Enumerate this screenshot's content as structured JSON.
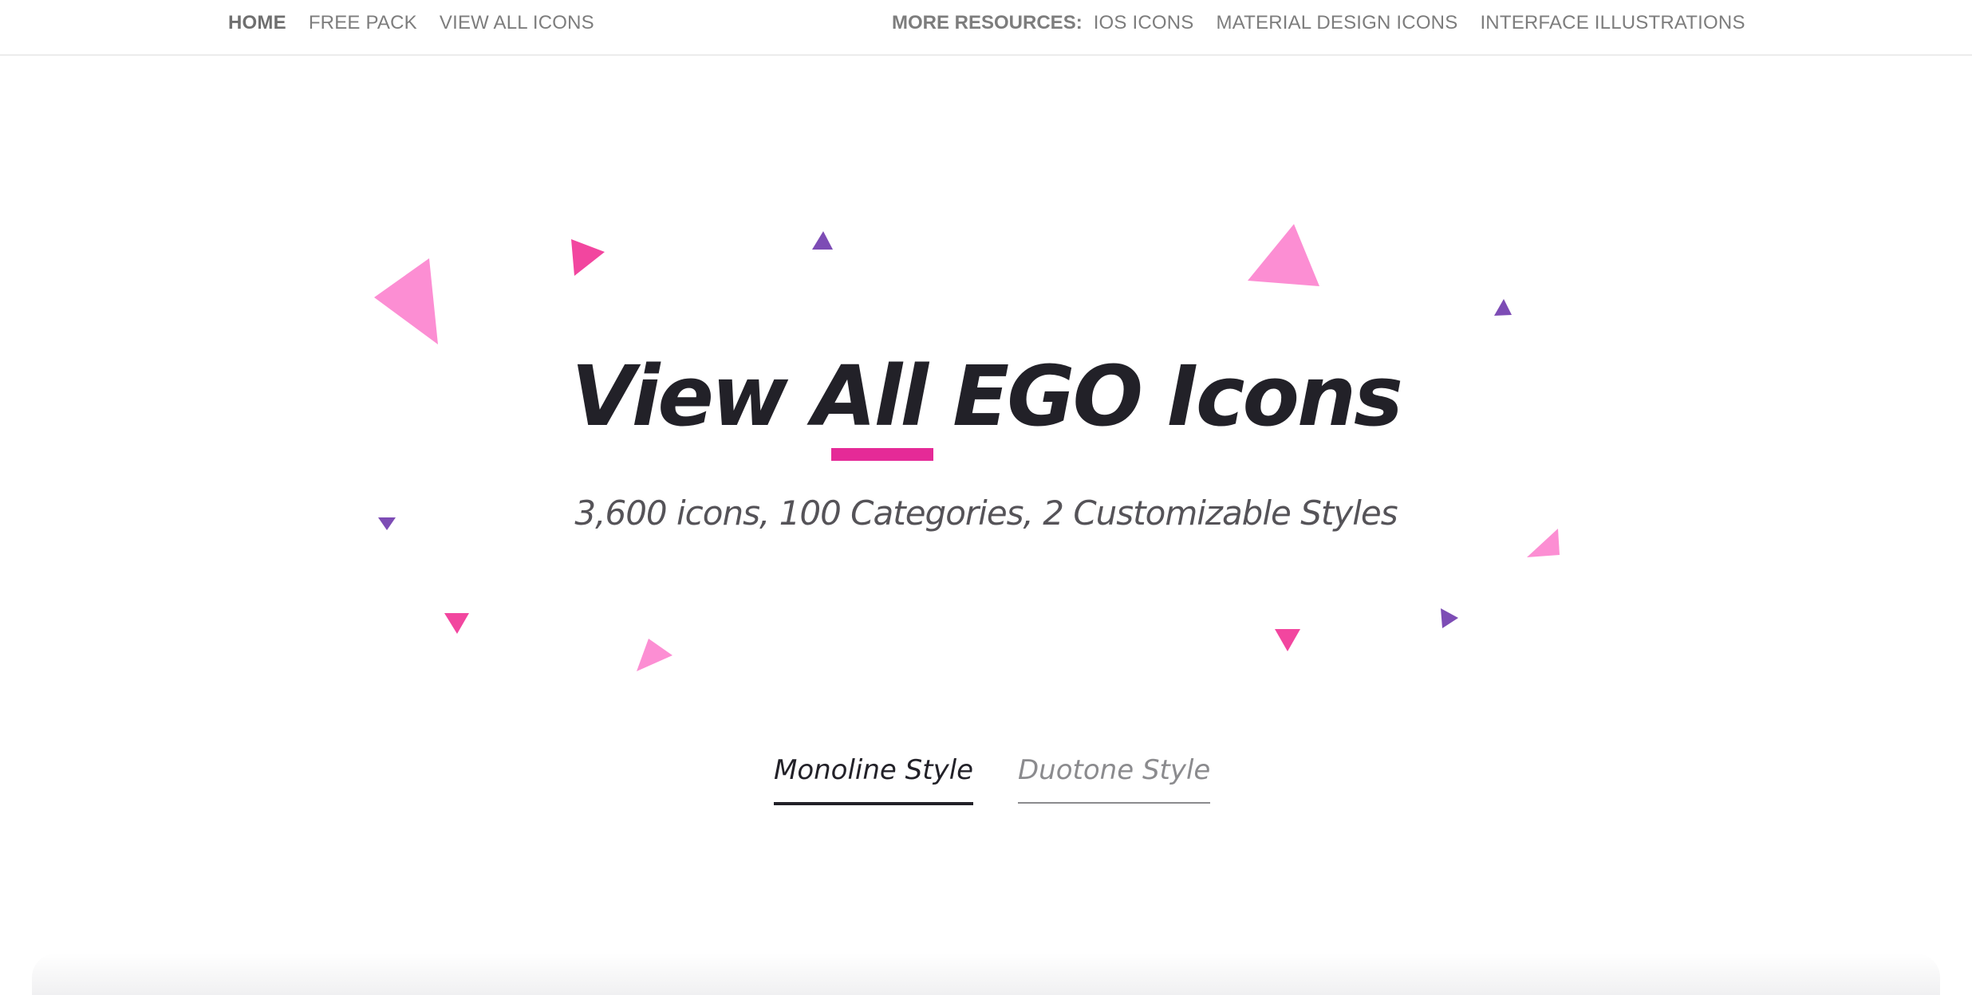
{
  "nav": {
    "left_items": [
      {
        "label": "HOME",
        "active": true
      },
      {
        "label": "FREE PACK",
        "active": false
      },
      {
        "label": "VIEW ALL ICONS",
        "active": false
      }
    ],
    "resources_label": "MORE RESOURCES:",
    "right_items": [
      {
        "label": "IOS ICONS"
      },
      {
        "label": "MATERIAL DESIGN ICONS"
      },
      {
        "label": "INTERFACE ILLUSTRATIONS"
      }
    ]
  },
  "hero": {
    "title": "View All EGO Icons",
    "subtitle": "3,600 icons, 100 Categories, 2 Customizable Styles"
  },
  "style_tabs": [
    {
      "label": "Monoline Style",
      "selected": true
    },
    {
      "label": "Duotone Style",
      "selected": false
    }
  ],
  "colors": {
    "accent_pink": "#e52a97",
    "light_pink": "#fc8ed3",
    "hot_pink": "#f2469f",
    "purple": "#7d4cb5",
    "title_text": "#222128",
    "nav_text": "#7d7d7d"
  }
}
